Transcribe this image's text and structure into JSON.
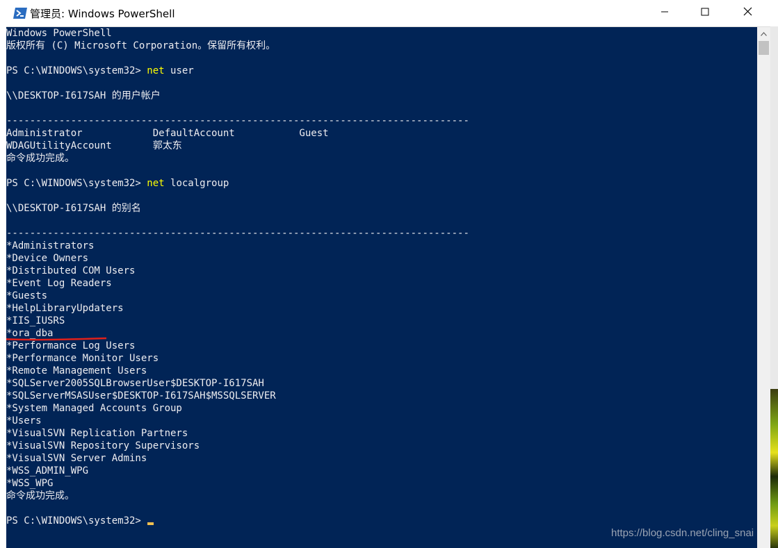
{
  "window": {
    "title": "管理员: Windows PowerShell",
    "icon": "powershell-icon",
    "controls": [
      "minimize-icon",
      "maximize-icon",
      "close-icon"
    ]
  },
  "console": {
    "colors": {
      "background": "#012456",
      "text": "#eeedf0",
      "command": "#ffff00",
      "cursor": "#f0c050",
      "annotation": "#e0201a"
    },
    "lines": [
      {
        "text": "Windows PowerShell"
      },
      {
        "text": "版权所有 (C) Microsoft Corporation。保留所有权利。"
      },
      {
        "text": ""
      },
      {
        "prompt": "PS C:\\WINDOWS\\system32> ",
        "cmd": "net",
        "args": " user"
      },
      {
        "text": ""
      },
      {
        "text": "\\\\DESKTOP-I617SAH 的用户帐户"
      },
      {
        "text": ""
      },
      {
        "text": "-------------------------------------------------------------------------------"
      },
      {
        "text": "Administrator            DefaultAccount           Guest"
      },
      {
        "text": "WDAGUtilityAccount       郭太东"
      },
      {
        "text": "命令成功完成。"
      },
      {
        "text": ""
      },
      {
        "prompt": "PS C:\\WINDOWS\\system32> ",
        "cmd": "net",
        "args": " localgroup"
      },
      {
        "text": ""
      },
      {
        "text": "\\\\DESKTOP-I617SAH 的别名"
      },
      {
        "text": ""
      },
      {
        "text": "-------------------------------------------------------------------------------"
      },
      {
        "text": "*Administrators"
      },
      {
        "text": "*Device Owners"
      },
      {
        "text": "*Distributed COM Users"
      },
      {
        "text": "*Event Log Readers"
      },
      {
        "text": "*Guests"
      },
      {
        "text": "*HelpLibraryUpdaters"
      },
      {
        "text": "*IIS_IUSRS"
      },
      {
        "text": "*ora_dba"
      },
      {
        "text": "*Performance Log Users"
      },
      {
        "text": "*Performance Monitor Users"
      },
      {
        "text": "*Remote Management Users"
      },
      {
        "text": "*SQLServer2005SQLBrowserUser$DESKTOP-I617SAH"
      },
      {
        "text": "*SQLServerMSASUser$DESKTOP-I617SAH$MSSQLSERVER"
      },
      {
        "text": "*System Managed Accounts Group"
      },
      {
        "text": "*Users"
      },
      {
        "text": "*VisualSVN Replication Partners"
      },
      {
        "text": "*VisualSVN Repository Supervisors"
      },
      {
        "text": "*VisualSVN Server Admins"
      },
      {
        "text": "*WSS_ADMIN_WPG"
      },
      {
        "text": "*WSS_WPG"
      },
      {
        "text": "命令成功完成。"
      },
      {
        "text": ""
      },
      {
        "prompt": "PS C:\\WINDOWS\\system32> ",
        "cursor": true
      }
    ]
  },
  "watermark": "https://blog.csdn.net/cling_snai"
}
